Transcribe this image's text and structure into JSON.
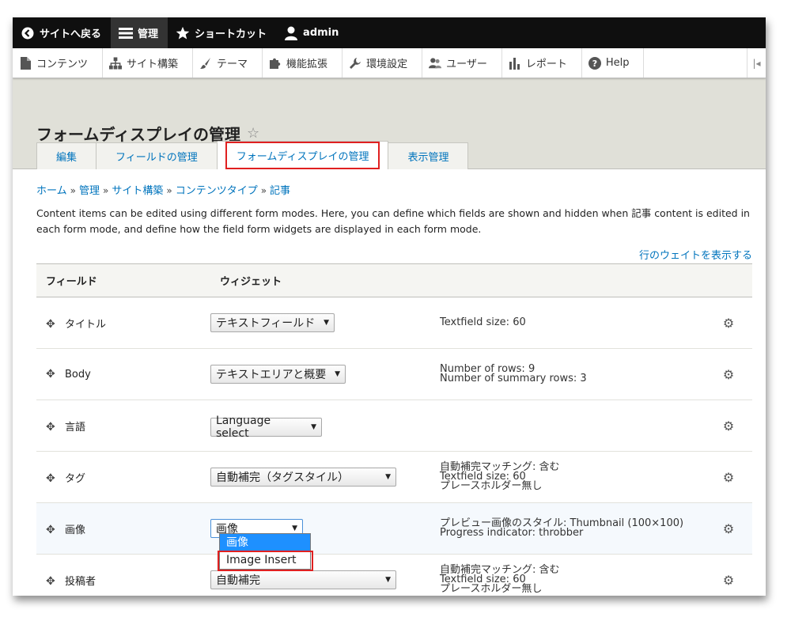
{
  "toolbar": {
    "back_label": "サイトへ戻る",
    "manage_label": "管理",
    "shortcuts_label": "ショートカット",
    "user_label": "admin"
  },
  "tray": {
    "items": [
      "コンテンツ",
      "サイト構築",
      "テーマ",
      "機能拡張",
      "環境設定",
      "ユーザー",
      "レポート",
      "Help"
    ]
  },
  "page": {
    "title": "フォームディスプレイの管理",
    "tabs": [
      "編集",
      "フィールドの管理",
      "フォームディスプレイの管理",
      "表示管理"
    ]
  },
  "breadcrumb": [
    "ホーム",
    "管理",
    "サイト構築",
    "コンテンツタイプ",
    "記事"
  ],
  "description": "Content items can be edited using different form modes. Here, you can define which fields are shown and hidden when 記事 content is edited in each form mode, and define how the field form widgets are displayed in each form mode.",
  "weights_link": "行のウェイトを表示する",
  "table": {
    "headers": [
      "フィールド",
      "ウィジェット"
    ],
    "rows": [
      {
        "field": "タイトル",
        "widget": "テキストフィールド",
        "summary": [
          "Textfield size: 60"
        ]
      },
      {
        "field": "Body",
        "widget": "テキストエリアと概要",
        "summary": [
          "Number of rows: 9",
          "Number of summary rows: 3"
        ]
      },
      {
        "field": "言語",
        "widget": "Language select",
        "summary": []
      },
      {
        "field": "タグ",
        "widget": "自動補完（タグスタイル）",
        "summary": [
          "自動補完マッチング: 含む",
          "Textfield size: 60",
          "プレースホルダー無し"
        ]
      },
      {
        "field": "画像",
        "widget": "画像",
        "summary": [
          "プレビュー画像のスタイル: Thumbnail (100×100)",
          "Progress indicator: throbber"
        ]
      },
      {
        "field": "投稿者",
        "widget": "自動補完",
        "summary": [
          "自動補完マッチング: 含む",
          "Textfield size: 60",
          "プレースホルダー無し"
        ]
      }
    ]
  },
  "dropdown": {
    "options": [
      "画像",
      "Image Insert"
    ]
  }
}
